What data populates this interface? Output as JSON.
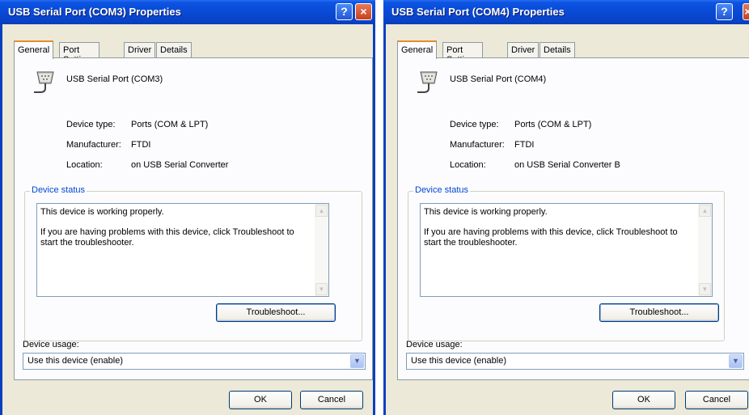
{
  "windows": [
    {
      "title": "USB Serial Port (COM3) Properties",
      "tabs": [
        "General",
        "Port Settings",
        "Driver",
        "Details"
      ],
      "device_name": "USB Serial Port (COM3)",
      "device_type_label": "Device type:",
      "device_type_value": "Ports (COM & LPT)",
      "manufacturer_label": "Manufacturer:",
      "manufacturer_value": "FTDI",
      "location_label": "Location:",
      "location_value": "on USB Serial Converter",
      "status_group_title": "Device status",
      "status_line1": "This device is working properly.",
      "status_line2": "If you are having problems with this device, click Troubleshoot to start the troubleshooter.",
      "troubleshoot_label": "Troubleshoot...",
      "usage_label": "Device usage:",
      "usage_value": "Use this device (enable)",
      "ok_label": "OK",
      "cancel_label": "Cancel"
    },
    {
      "title": "USB Serial Port (COM4) Properties",
      "tabs": [
        "General",
        "Port Settings",
        "Driver",
        "Details"
      ],
      "device_name": "USB Serial Port (COM4)",
      "device_type_label": "Device type:",
      "device_type_value": "Ports (COM & LPT)",
      "manufacturer_label": "Manufacturer:",
      "manufacturer_value": "FTDI",
      "location_label": "Location:",
      "location_value": "on USB Serial Converter B",
      "status_group_title": "Device status",
      "status_line1": "This device is working properly.",
      "status_line2": "If you are having problems with this device, click Troubleshoot to start the troubleshooter.",
      "troubleshoot_label": "Troubleshoot...",
      "usage_label": "Device usage:",
      "usage_value": "Use this device (enable)",
      "ok_label": "OK",
      "cancel_label": "Cancel"
    }
  ],
  "icons": {
    "help": "?",
    "close": "×",
    "device": "serial-port-icon",
    "dropdown": "chevron-down-icon"
  },
  "colors": {
    "titlebar": "#0a4ad6",
    "dialog_bg": "#ece9d8",
    "active_tab_accent": "#e68b2c",
    "group_title": "#0046d5"
  }
}
